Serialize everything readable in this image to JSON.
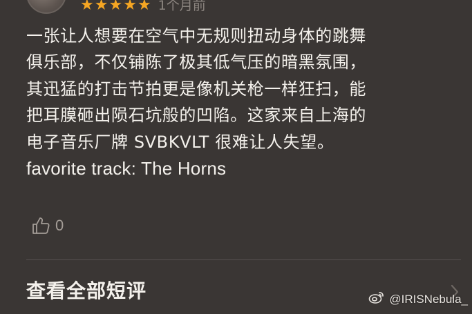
{
  "review": {
    "rating": 5,
    "rating_max": 5,
    "stars": [
      "★",
      "★",
      "★",
      "★",
      "★"
    ],
    "time": "1个月前",
    "lines": [
      "一张让人想要在空气中无规则扭动身体的跳舞",
      "俱乐部，不仅铺陈了极其低气压的暗黑氛围，",
      "其迅猛的打击节拍更是像机关枪一样狂扫，能",
      "把耳膜砸出陨石坑般的凹陷。这家来自上海的",
      "电子音乐厂牌 SVBKVLT 很难让人失望。"
    ],
    "favorite": "favorite track: The Horns",
    "likes": "0"
  },
  "footer": {
    "all_reviews_label": "查看全部短评"
  },
  "watermark": {
    "text": "@IRISNebula_"
  },
  "colors": {
    "background": "#3a3634",
    "star": "#f5a623",
    "muted": "#8c8580",
    "text": "#f4f1ec",
    "divider": "#565150"
  },
  "icons": {
    "like": "thumbs-up-icon",
    "chevron": "chevron-right-icon",
    "weibo": "weibo-logo-icon"
  }
}
